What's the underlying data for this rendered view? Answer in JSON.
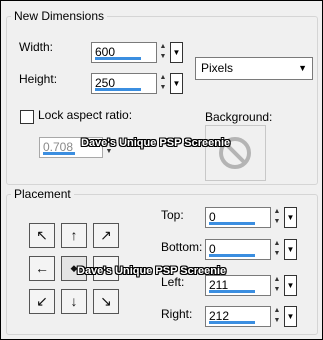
{
  "new_dimensions": {
    "title": "New Dimensions",
    "width_label": "Width:",
    "width_value": "600",
    "height_label": "Height:",
    "height_value": "250",
    "units_selected": "Pixels",
    "lock_label": "Lock aspect ratio:",
    "lock_checked": false,
    "ratio_value": "0.708",
    "background_label": "Background:"
  },
  "placement": {
    "title": "Placement",
    "top_label": "Top:",
    "top_value": "0",
    "bottom_label": "Bottom:",
    "bottom_value": "0",
    "left_label": "Left:",
    "left_value": "211",
    "right_label": "Right:",
    "right_value": "212"
  },
  "watermark_text": "Dave's Unique PSP Screenie",
  "icons": {
    "spin_up": "▲",
    "spin_down": "▼",
    "dropdown": "▼",
    "no_background": "no-entry",
    "nw": "↖",
    "n": "↑",
    "ne": "↗",
    "w": "←",
    "center": "◆",
    "e": "→",
    "sw": "↙",
    "s": "↓",
    "se": "↘"
  },
  "colors": {
    "slider_bar": "#3b8ee0",
    "panel_bg": "#f0f0f0"
  }
}
